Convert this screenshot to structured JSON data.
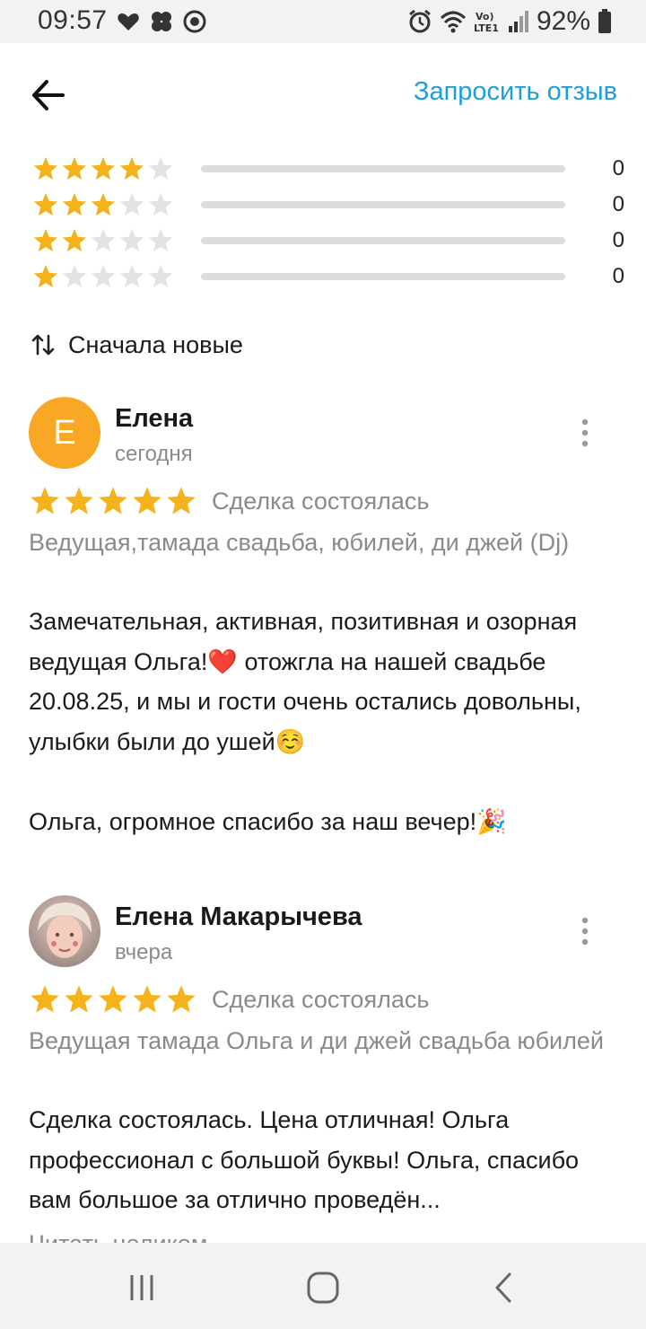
{
  "status_bar": {
    "time": "09:57",
    "network_label": "Vo)\nLTE1",
    "battery": "92%"
  },
  "header": {
    "request_review": "Запросить отзыв"
  },
  "distribution": [
    {
      "stars": 4,
      "count": "0",
      "fraction": 0
    },
    {
      "stars": 3,
      "count": "0",
      "fraction": 0
    },
    {
      "stars": 2,
      "count": "0",
      "fraction": 0
    },
    {
      "stars": 1,
      "count": "0",
      "fraction": 0
    }
  ],
  "sort": {
    "label": "Сначала новые"
  },
  "reviews": [
    {
      "avatar_letter": "Е",
      "name": "Елена",
      "date": "сегодня",
      "rating": 5,
      "deal_status": "Сделка состоялась",
      "service": "Ведущая,тамада свадьба, юбилей, ди джей (Dj)",
      "text": "Замечательная, активная, позитивная и озорная ведущая Ольга!❤️ отожгла на нашей свадьбе 20.08.25, и мы и гости очень остались довольны, улыбки были до ушей☺️\n\nОльга, огромное спасибо за наш вечер!🎉"
    },
    {
      "avatar_letter": "",
      "name": "Елена Макарычева",
      "date": "вчера",
      "rating": 5,
      "deal_status": "Сделка состоялась",
      "service": "Ведущая тамада Ольга и ди джей свадьба юбилей",
      "text": "Сделка состоялась. Цена отличная! Ольга профессионал с большой буквы! Ольга, спасибо  вам большое за отлично проведён...",
      "read_all": "Читать целиком"
    }
  ],
  "colors": {
    "accent": "#1e9ed9",
    "star_filled": "#f6b21b",
    "star_empty": "#e3e3e3",
    "avatar_bg": "#f9a825"
  }
}
